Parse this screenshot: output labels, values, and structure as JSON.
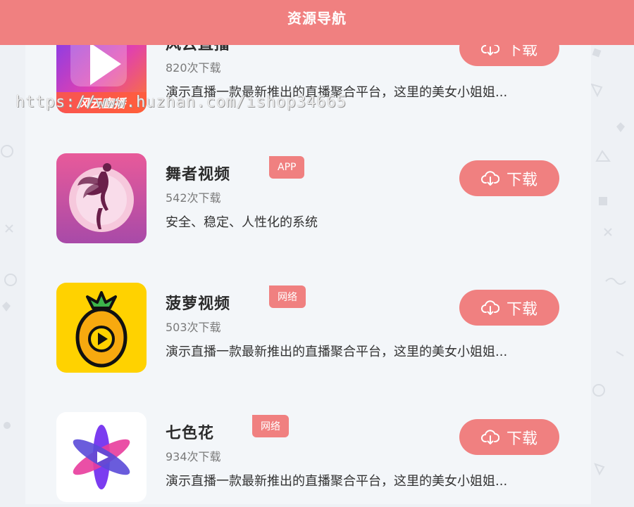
{
  "header": {
    "title": "资源导航"
  },
  "watermark": "https://www.huzhan.com/ishop34665",
  "accent": "#f08080",
  "items": [
    {
      "name": "风云直播",
      "tag": "",
      "count": "820次下载",
      "desc": "演示直播一款最新推出的直播聚合平台，这里的美女小姐姐...",
      "download_label": "下载",
      "icon": "fengyun-app-icon",
      "icon_text": "风云直播"
    },
    {
      "name": "舞者视频",
      "tag": "APP",
      "count": "542次下载",
      "desc": "安全、稳定、人性化的系统",
      "download_label": "下载",
      "icon": "dancer-app-icon"
    },
    {
      "name": "菠萝视频",
      "tag": "网络",
      "count": "503次下载",
      "desc": "演示直播一款最新推出的直播聚合平台，这里的美女小姐姐...",
      "download_label": "下载",
      "icon": "pineapple-app-icon"
    },
    {
      "name": "七色花",
      "tag": "网络",
      "count": "934次下载",
      "desc": "演示直播一款最新推出的直播聚合平台，这里的美女小姐姐...",
      "download_label": "下载",
      "icon": "seven-color-flower-app-icon"
    }
  ]
}
